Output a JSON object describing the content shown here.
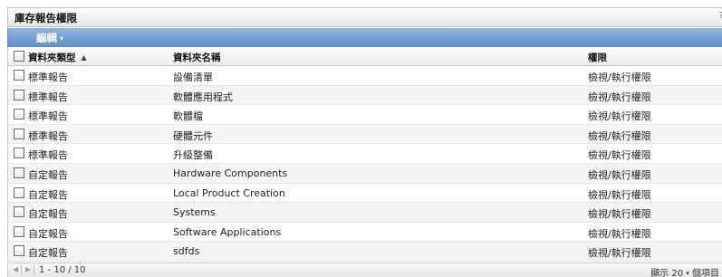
{
  "panel": {
    "title": "庫存報告權限",
    "help_glyph": "?"
  },
  "toolbar": {
    "edit_label": "編輯",
    "edit_caret": "▾"
  },
  "table": {
    "columns": {
      "type": "資料夾類型",
      "name": "資料夾名稱",
      "permission": "權限"
    },
    "sort_indicator": "▲",
    "rows": [
      {
        "type": "標準報告",
        "name": "設備清單",
        "permission": "檢視/執行權限"
      },
      {
        "type": "標準報告",
        "name": "軟體應用程式",
        "permission": "檢視/執行權限"
      },
      {
        "type": "標準報告",
        "name": "軟體檔",
        "permission": "檢視/執行權限"
      },
      {
        "type": "標準報告",
        "name": "硬體元件",
        "permission": "檢視/執行權限"
      },
      {
        "type": "標準報告",
        "name": "升級整備",
        "permission": "檢視/執行權限"
      },
      {
        "type": "自定報告",
        "name": "Hardware Components",
        "permission": "檢視/執行權限"
      },
      {
        "type": "自定報告",
        "name": "Local Product Creation",
        "permission": "檢視/執行權限"
      },
      {
        "type": "自定報告",
        "name": "Systems",
        "permission": "檢視/執行權限"
      },
      {
        "type": "自定報告",
        "name": "Software Applications",
        "permission": "檢視/執行權限"
      },
      {
        "type": "自定報告",
        "name": "sdfds",
        "permission": "檢視/執行權限"
      }
    ]
  },
  "footer": {
    "prev_glyph": "◀",
    "next_glyph": "▶",
    "range": "1 - 10 / 10",
    "show_label": "顯示",
    "page_size": "20",
    "page_size_caret": "▾",
    "items_label": "個項目"
  }
}
